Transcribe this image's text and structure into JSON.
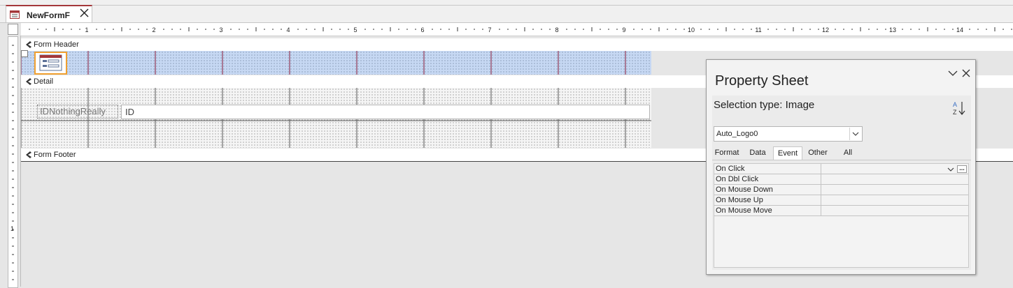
{
  "document": {
    "tab_title": "NewFormF",
    "accent_color": "#a4373a"
  },
  "ruler": {
    "horizontal_labels": [
      "1",
      "2",
      "3",
      "4",
      "5",
      "6",
      "7",
      "8",
      "9",
      "10",
      "11",
      "12",
      "13",
      "14"
    ],
    "vertical_labels": [
      "1"
    ]
  },
  "sections": {
    "form_header": "Form Header",
    "detail": "Detail",
    "form_footer": "Form Footer"
  },
  "controls": {
    "label_text": "IDNothingReally",
    "textbox_text": "ID"
  },
  "property_sheet": {
    "title": "Property Sheet",
    "selection_type_label": "Selection type:",
    "selection_type_value": "Image",
    "selected_object": "Auto_Logo0",
    "tabs": [
      {
        "label": "Format",
        "active": false
      },
      {
        "label": "Data",
        "active": false
      },
      {
        "label": "Event",
        "active": true
      },
      {
        "label": "Other",
        "active": false
      },
      {
        "label": "All",
        "active": false
      }
    ],
    "properties": [
      {
        "name": "On Click",
        "value": ""
      },
      {
        "name": "On Dbl Click",
        "value": ""
      },
      {
        "name": "On Mouse Down",
        "value": ""
      },
      {
        "name": "On Mouse Up",
        "value": ""
      },
      {
        "name": "On Mouse Move",
        "value": ""
      }
    ],
    "build_button_label": "...",
    "sort_icon": "sort-ascending-icon"
  },
  "colors": {
    "selected_outline": "#f0a030",
    "header_grid": "#c6d8f3"
  }
}
